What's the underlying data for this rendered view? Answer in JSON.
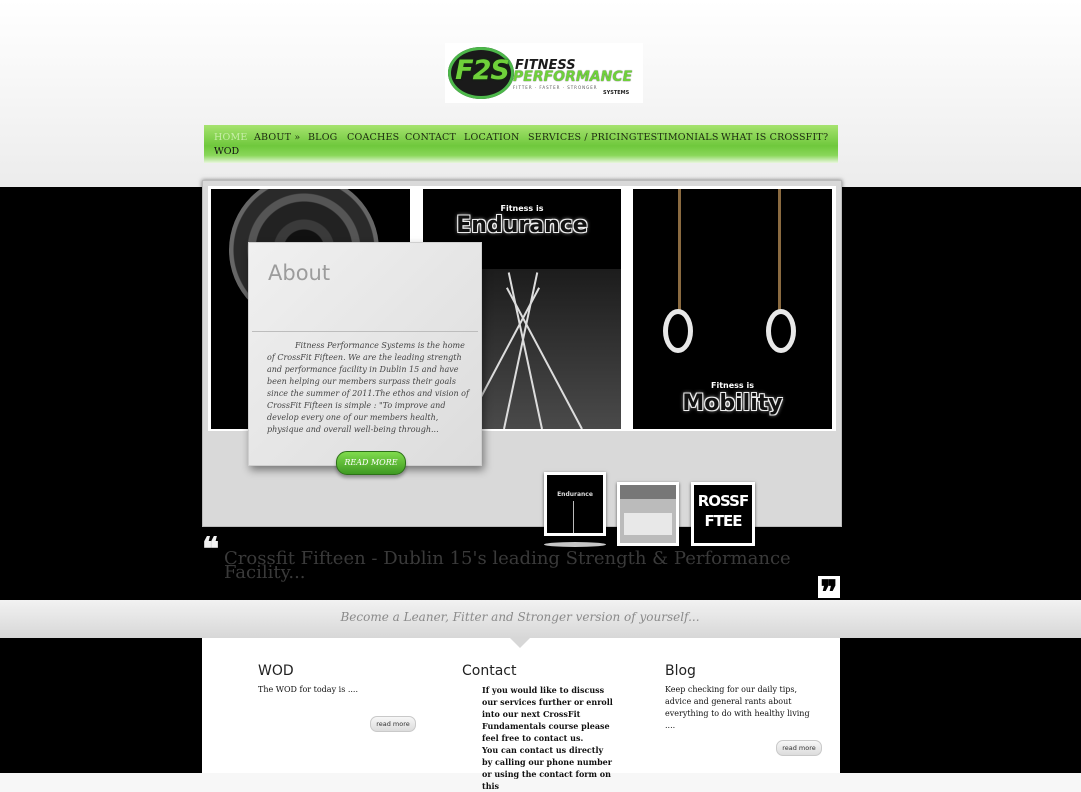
{
  "brand": {
    "logo_letters": "F2S",
    "logo_word1": "FITNESS",
    "logo_word2": "PERFORMANCE",
    "logo_tagline": "FITTER · FASTER · STRONGER",
    "logo_word3": "SYSTEMS"
  },
  "nav": {
    "items": [
      {
        "label": "HOME"
      },
      {
        "label": "ABOUT »"
      },
      {
        "label": "BLOG"
      },
      {
        "label": "COACHES"
      },
      {
        "label": "CONTACT"
      },
      {
        "label": "LOCATION"
      },
      {
        "label": "SERVICES / PRICING"
      },
      {
        "label": "TESTIMONIALS"
      },
      {
        "label": "WHAT IS CROSSFIT?"
      }
    ],
    "second_row": "WOD"
  },
  "slider": {
    "panels": [
      {
        "small": "",
        "big": ""
      },
      {
        "small": "Fitness is",
        "big": "Endurance"
      },
      {
        "small": "Fitness is",
        "big": "Mobility"
      }
    ],
    "thumbs": [
      {
        "text": "Endurance"
      },
      {
        "text": ""
      },
      {
        "text": "ROSSF FTEE"
      }
    ]
  },
  "about": {
    "title": "About",
    "text": "Fitness Performance Systems is the home of CrossFit Fifteen. We are the leading strength and performance facility in Dublin 15 and have been helping our members surpass their goals since the summer of 2011.The ethos and vision of CrossFit Fifteen is simple : \"To improve and develop every one of our members health, physique and overall well-being through...",
    "button": "READ MORE"
  },
  "headline": {
    "open_quote": "❝",
    "text": "Crossfit Fifteen - Dublin 15's leading Strength & Performance Facility...",
    "close_quote": "❞"
  },
  "subtitle": "Become a Leaner, Fitter and Stronger version of yourself...",
  "columns": {
    "wod": {
      "title": "WOD",
      "text": "The WOD for today is ....",
      "button": "read more"
    },
    "contact": {
      "title": "Contact",
      "text1": "If you would like to discuss our services further or enroll into our next CrossFit Fundamentals course please feel free to contact us.",
      "text2": "You can contact us directly by calling our phone number or using the contact form on this"
    },
    "blog": {
      "title": "Blog",
      "text": "Keep checking for our daily tips, advice and general rants about everything to do with healthy living ....",
      "button": "read more"
    }
  },
  "colors": {
    "brand_green": "#6fc83c",
    "dark": "#000000"
  }
}
